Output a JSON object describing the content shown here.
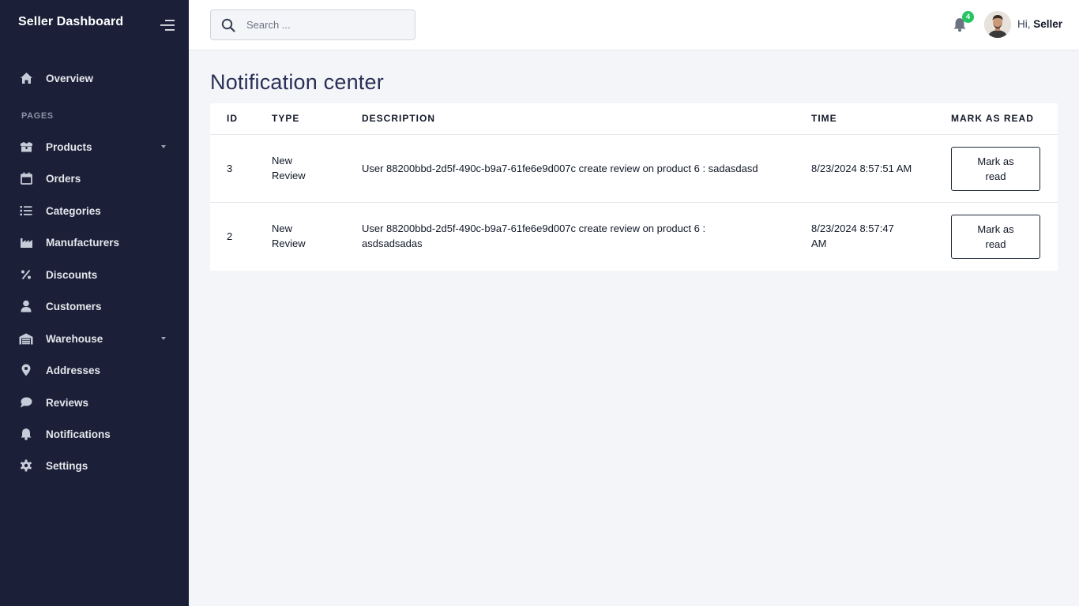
{
  "sidebar": {
    "brand": "Seller Dashboard",
    "section_label": "PAGES",
    "items": [
      {
        "label": "Overview",
        "icon": "home-icon"
      },
      {
        "label": "Products",
        "icon": "box-icon",
        "has_caret": true
      },
      {
        "label": "Orders",
        "icon": "calendar-icon"
      },
      {
        "label": "Categories",
        "icon": "list-icon"
      },
      {
        "label": "Manufacturers",
        "icon": "factory-icon"
      },
      {
        "label": "Discounts",
        "icon": "percent-icon"
      },
      {
        "label": "Customers",
        "icon": "user-icon"
      },
      {
        "label": "Warehouse",
        "icon": "warehouse-icon",
        "has_caret": true
      },
      {
        "label": "Addresses",
        "icon": "map-pin-icon"
      },
      {
        "label": "Reviews",
        "icon": "chat-icon"
      },
      {
        "label": "Notifications",
        "icon": "bell-icon"
      },
      {
        "label": "Settings",
        "icon": "gear-icon"
      }
    ]
  },
  "topbar": {
    "search_placeholder": "Search ...",
    "notification_count": "4",
    "greeting_prefix": "Hi, ",
    "user_name": "Seller"
  },
  "main": {
    "title": "Notification center",
    "columns": [
      "ID",
      "TYPE",
      "DESCRIPTION",
      "TIME",
      "MARK AS READ"
    ],
    "rows": [
      {
        "id": "3",
        "type": "New Review",
        "description": "User 88200bbd-2d5f-490c-b9a7-61fe6e9d007c create review on product 6 : sadasdasd",
        "time": "8/23/2024 8:57:51 AM",
        "action": "Mark as read"
      },
      {
        "id": "2",
        "type": "New Review",
        "description": "User 88200bbd-2d5f-490c-b9a7-61fe6e9d007c create review on product 6 : asdsadsadas",
        "time": "8/23/2024 8:57:47 AM",
        "action": "Mark as read"
      }
    ]
  },
  "colors": {
    "sidebar_bg": "#1b1f38",
    "page_bg": "#f4f5f9",
    "title_color": "#2a2f56",
    "badge": "#22c55e"
  }
}
